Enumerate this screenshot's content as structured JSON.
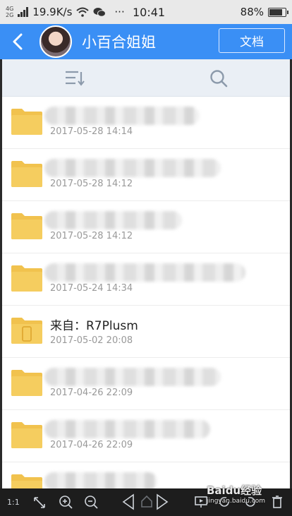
{
  "status_bar": {
    "network_type": "4G",
    "network_type_2": "2G",
    "speed": "19.9K/s",
    "time": "10:41",
    "battery": "88%",
    "battery_level": 0.88,
    "more": "···",
    "icons": [
      "signal-icon",
      "wifi-icon",
      "wechat-icon",
      "battery-icon"
    ]
  },
  "header": {
    "title": "小百合姐姐",
    "doc_button": "文档",
    "accent_color": "#3a8ff5"
  },
  "toolbar": {
    "icons": [
      "sort-icon",
      "search-icon"
    ]
  },
  "files": [
    {
      "name": "",
      "date": "2017-05-28  14:14",
      "blurred": true
    },
    {
      "name": "",
      "date": "2017-05-28  14:12",
      "blurred": true
    },
    {
      "name": "",
      "date": "2017-05-28  14:12",
      "blurred": true
    },
    {
      "name": "",
      "date": "2017-05-24  14:34",
      "blurred": true
    },
    {
      "name": "来自：R7Plusm",
      "date": "2017-05-02  20:08",
      "blurred": false,
      "device_folder": true
    },
    {
      "name": "",
      "date": "2017-04-26  22:09",
      "blurred": true
    },
    {
      "name": "",
      "date": "2017-04-26  22:09",
      "blurred": true
    },
    {
      "name": "",
      "date": "",
      "blurred": true
    }
  ],
  "bottom_bar": {
    "ratio_label": "1:1",
    "watermark": "Baidu经验",
    "watermark_sub": "jingyan.baidu.com"
  }
}
